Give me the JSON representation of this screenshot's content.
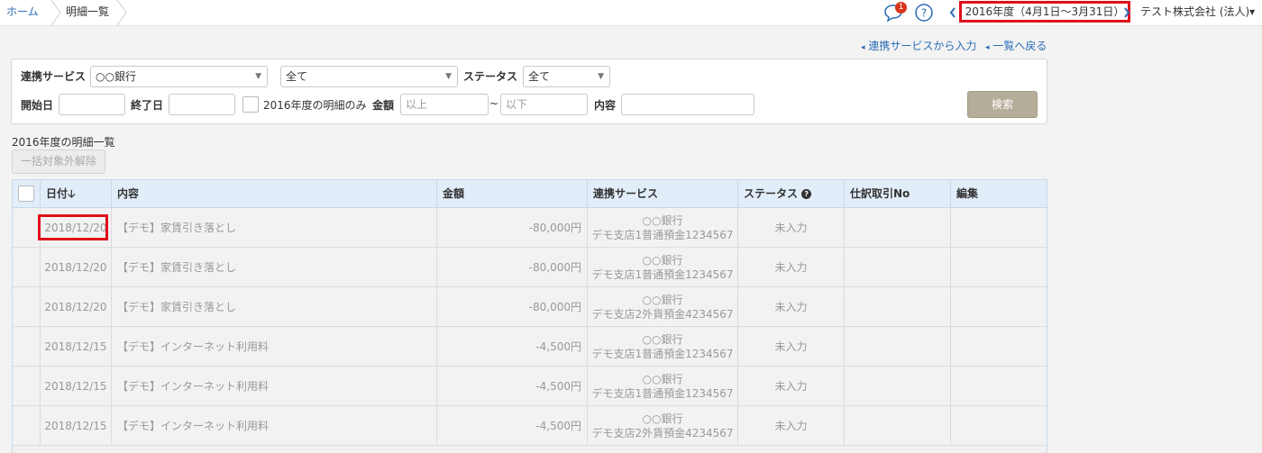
{
  "breadcrumb": {
    "home": "ホーム",
    "current": "明細一覧"
  },
  "header": {
    "notification_count": "1",
    "fiscal_year": "2016年度（4月1日〜3月31日）",
    "prev_icon": "chevron-left-icon",
    "next_icon": "chevron-right-icon",
    "company": "テスト株式会社 (法人)▾"
  },
  "links": {
    "import": "連携サービスから入力",
    "back": "一覧へ戻る"
  },
  "filter": {
    "service_label": "連携サービス",
    "service_value": "○○銀行",
    "account_value": "全て",
    "status_label": "ステータス",
    "status_value": "全て",
    "start_label": "開始日",
    "end_label": "終了日",
    "fy_only_label": "2016年度の明細のみ",
    "amount_label": "金額",
    "min_placeholder": "以上",
    "tilde": "~",
    "max_placeholder": "以下",
    "content_label": "内容",
    "search_button": "検索"
  },
  "list": {
    "title": "2016年度の明細一覧",
    "bulk_button": "一括対象外解除"
  },
  "table": {
    "headers": {
      "date": "日付",
      "sort_icon": "🡣",
      "content": "内容",
      "amount": "金額",
      "service": "連携サービス",
      "status": "ステータス",
      "help_icon": "?",
      "journal": "仕訳取引No",
      "edit": "編集"
    },
    "rows": [
      {
        "date": "2018/12/20",
        "content": "【デモ】家賃引き落とし",
        "amount": "-80,000円",
        "bank": "○○銀行",
        "account": "デモ支店1普通預金1234567",
        "status": "未入力"
      },
      {
        "date": "2018/12/20",
        "content": "【デモ】家賃引き落とし",
        "amount": "-80,000円",
        "bank": "○○銀行",
        "account": "デモ支店1普通預金1234567",
        "status": "未入力"
      },
      {
        "date": "2018/12/20",
        "content": "【デモ】家賃引き落とし",
        "amount": "-80,000円",
        "bank": "○○銀行",
        "account": "デモ支店2外貨預金4234567",
        "status": "未入力"
      },
      {
        "date": "2018/12/15",
        "content": "【デモ】インターネット利用料",
        "amount": "-4,500円",
        "bank": "○○銀行",
        "account": "デモ支店1普通預金1234567",
        "status": "未入力"
      },
      {
        "date": "2018/12/15",
        "content": "【デモ】インターネット利用料",
        "amount": "-4,500円",
        "bank": "○○銀行",
        "account": "デモ支店1普通預金1234567",
        "status": "未入力"
      },
      {
        "date": "2018/12/15",
        "content": "【デモ】インターネット利用料",
        "amount": "-4,500円",
        "bank": "○○銀行",
        "account": "デモ支店2外貨預金4234567",
        "status": "未入力"
      }
    ]
  }
}
